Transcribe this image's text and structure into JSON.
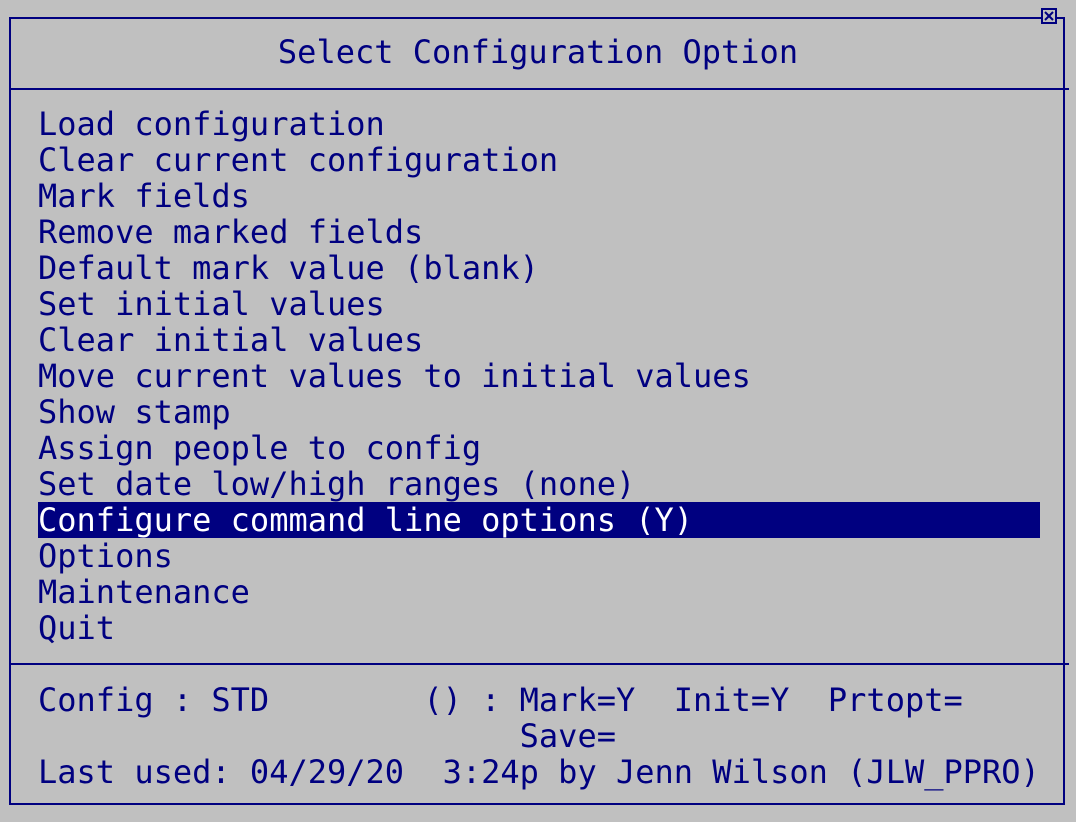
{
  "window": {
    "title": "Select Configuration Option",
    "close_icon": "close-icon",
    "colors": {
      "background": "#c0c0c0",
      "foreground": "#000080",
      "highlight_bg": "#000080",
      "highlight_fg": "#ffffff"
    }
  },
  "menu": {
    "selected_index": 11,
    "items": [
      {
        "label": "Load configuration"
      },
      {
        "label": "Clear current configuration"
      },
      {
        "label": "Mark fields"
      },
      {
        "label": "Remove marked fields"
      },
      {
        "label": "Default mark value (blank)"
      },
      {
        "label": "Set initial values"
      },
      {
        "label": "Clear initial values"
      },
      {
        "label": "Move current values to initial values"
      },
      {
        "label": "Show stamp"
      },
      {
        "label": "Assign people to config"
      },
      {
        "label": "Set date low/high ranges (none)"
      },
      {
        "label": "Configure command line options (Y)"
      },
      {
        "label": "Options"
      },
      {
        "label": "Maintenance"
      },
      {
        "label": "Quit"
      }
    ]
  },
  "status": {
    "line1": "Config : STD        () : Mark=Y  Init=Y  Prtopt=",
    "line2": "                         Save=",
    "line3": "Last used: 04/29/20  3:24p by Jenn Wilson (JLW_PPRO)"
  }
}
